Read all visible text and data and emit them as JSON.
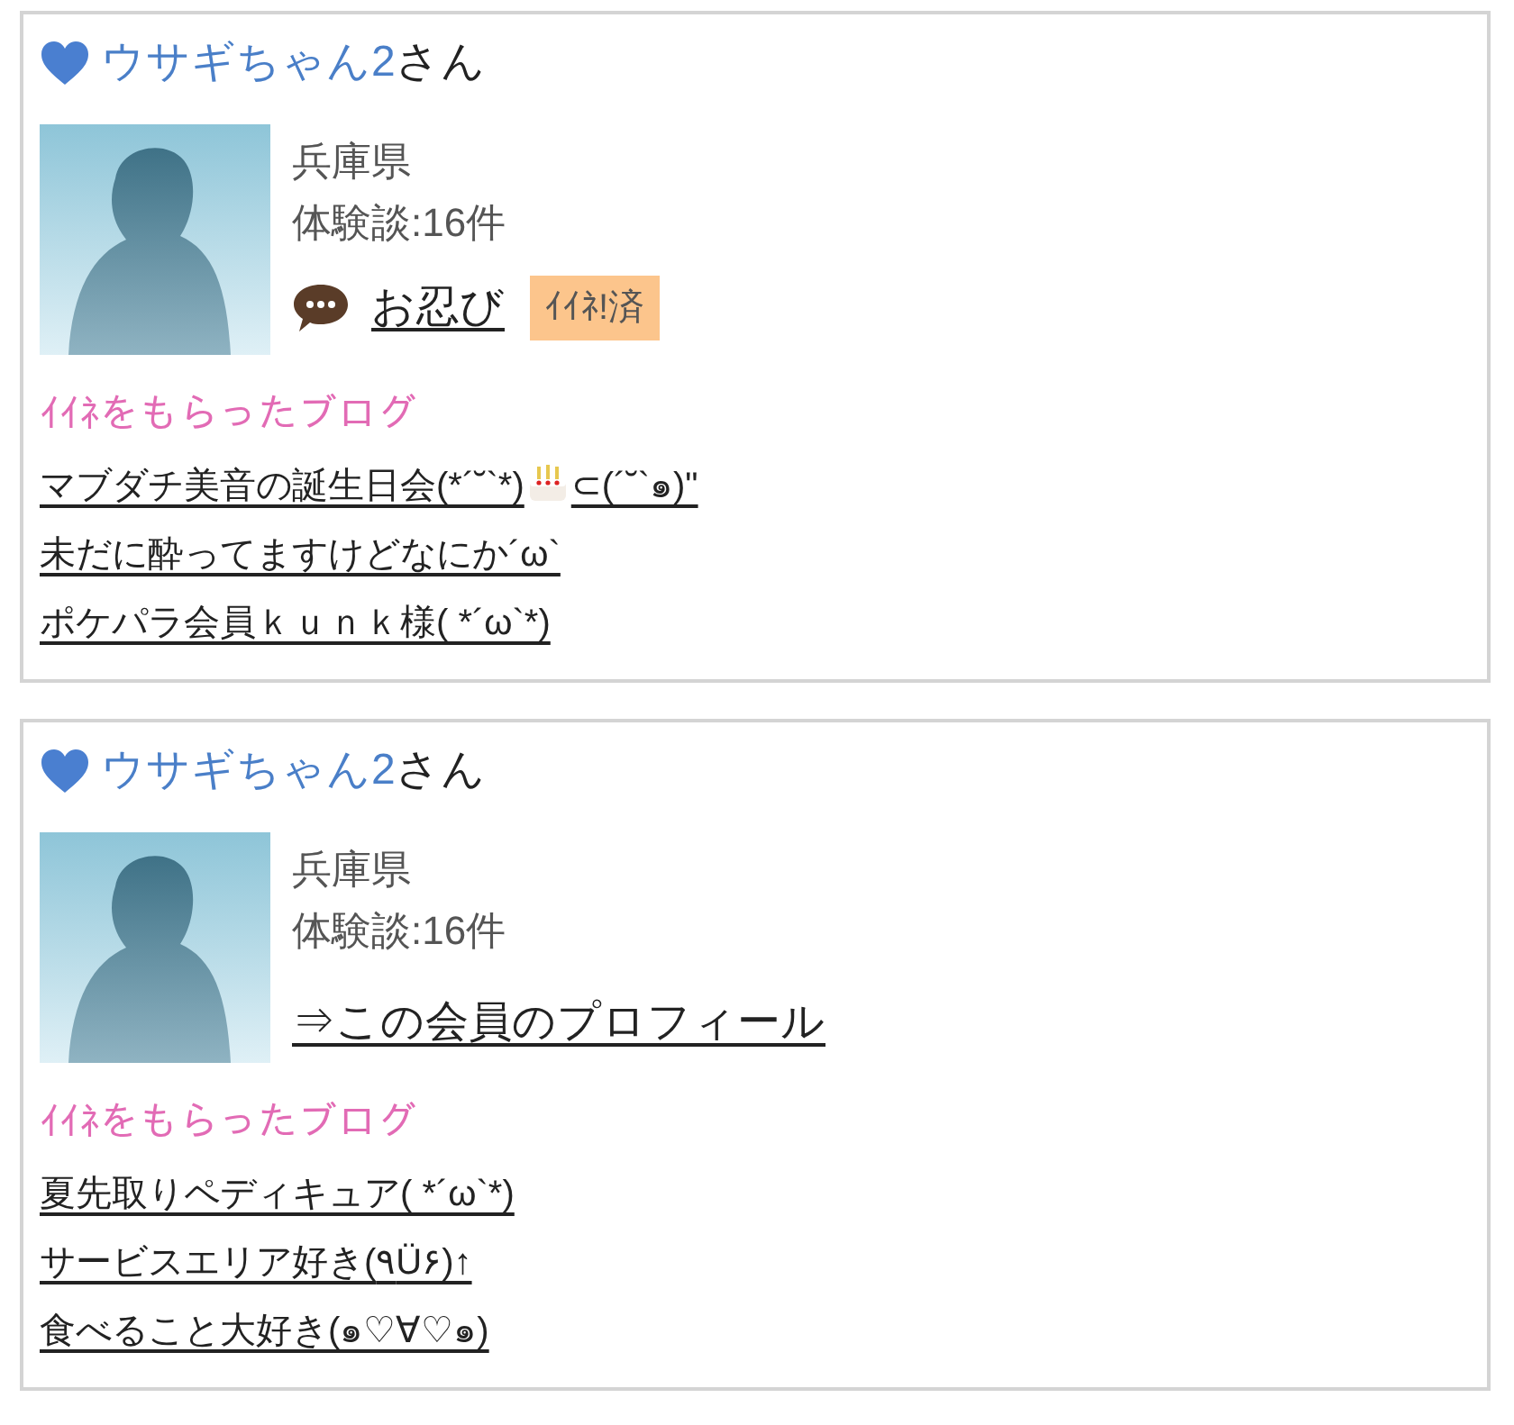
{
  "cards": [
    {
      "name": "ウサギちゃん2",
      "suffix": "さん",
      "region": "兵庫県",
      "reviews": "体験談:16件",
      "action": {
        "kind": "nickname",
        "label": "お忍び",
        "badge": "ｲｲﾈ!済"
      },
      "blog_heading": "ｲｲﾈをもらったブログ",
      "blogs": [
        {
          "kind": "cake",
          "text": "マブダチ美音の誕生日会(*´˘`*)",
          "text_after": "⊂(´˘`๑)\""
        },
        {
          "kind": "plain",
          "text": "未だに酔ってますけどなにか´ω`"
        },
        {
          "kind": "plain",
          "text": "ポケパラ会員ｋｕｎｋ様( *´ω`*)"
        }
      ]
    },
    {
      "name": "ウサギちゃん2",
      "suffix": "さん",
      "region": "兵庫県",
      "reviews": "体験談:16件",
      "action": {
        "kind": "profile_link",
        "label": "⇒この会員のプロフィール"
      },
      "blog_heading": "ｲｲﾈをもらったブログ",
      "blogs": [
        {
          "kind": "plain",
          "text": "夏先取りペディキュア( *´ω`*)"
        },
        {
          "kind": "plain",
          "text": "サービスエリア好き(٩Ü۶)↑"
        },
        {
          "kind": "plain",
          "text": "食べること大好き(๑♡∀♡๑)"
        }
      ]
    }
  ]
}
